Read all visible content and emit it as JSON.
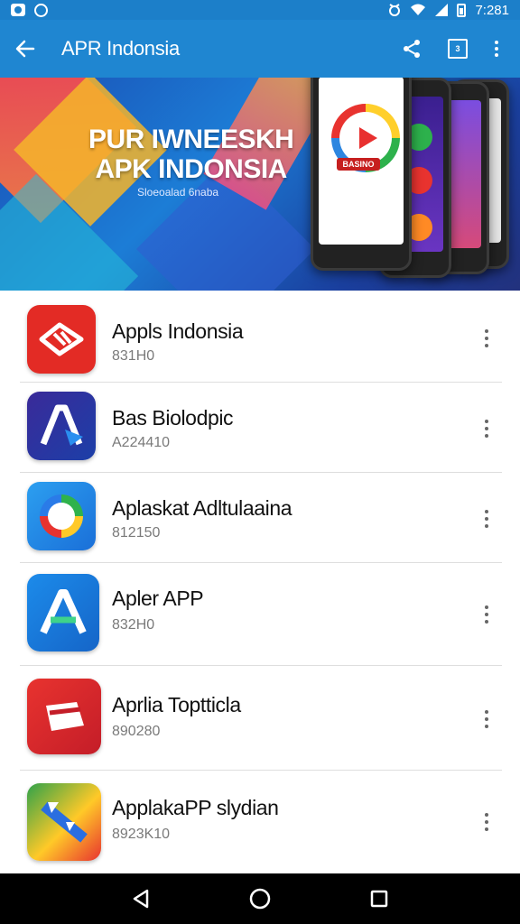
{
  "status_bar": {
    "time": "7:281"
  },
  "app_bar": {
    "title": "APR Indonsia"
  },
  "banner": {
    "title_line1": "PUR IWNEESKH",
    "title_line2": "APK INDONSIA",
    "subtitle": "Sloeoalad 6naba",
    "phone_badge": "BASINO"
  },
  "apps": [
    {
      "name": "Appls Indonsia",
      "meta": "831H0",
      "icon": "red-bird-icon",
      "color": "#e32b25"
    },
    {
      "name": "Bas Biolodpic",
      "meta": "A224410",
      "icon": "letter-a-arrow-icon",
      "color": "#2b2f8c"
    },
    {
      "name": "Aplaskat Adltulaaina",
      "meta": "812150",
      "icon": "color-ring-icon",
      "color": "#2a8fe6"
    },
    {
      "name": "Apler APP",
      "meta": "832H0",
      "icon": "letter-a-icon",
      "color": "#1a7ee0"
    },
    {
      "name": "Aprlia Toptticla",
      "meta": "890280",
      "icon": "red-card-icon",
      "color": "#e02a2a"
    },
    {
      "name": "ApplakaPP slydian",
      "meta": "8923K10",
      "icon": "colorful-tile-icon",
      "color": "#2fa24a"
    }
  ],
  "colors": {
    "primary": "#1f86d1",
    "status": "#1c7fc9"
  }
}
